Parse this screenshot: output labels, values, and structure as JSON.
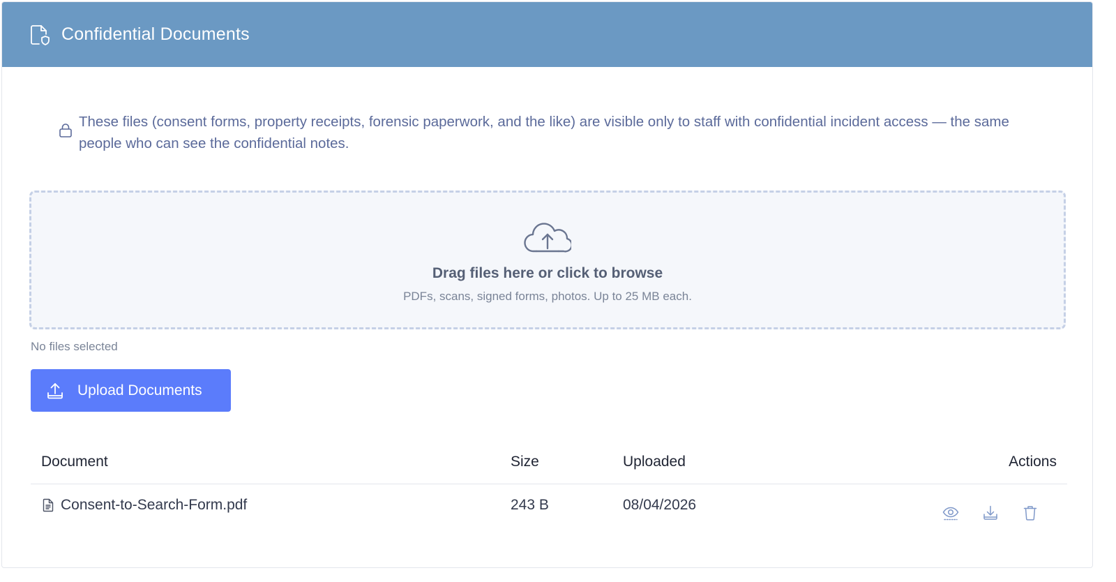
{
  "header": {
    "title": "Confidential Documents",
    "icon": "file-shield-icon",
    "background": "#6b99c3"
  },
  "notice": {
    "icon": "lock-icon",
    "text": "These files (consent forms, property receipts, forensic paperwork, and the like) are visible only to staff with confidential incident access — the same people who can see the confidential notes."
  },
  "dropzone": {
    "icon": "cloud-upload-icon",
    "title": "Drag files here or click to browse",
    "subtitle": "PDFs, scans, signed forms, photos. Up to 25 MB each."
  },
  "file_status": "No files selected",
  "upload_button": {
    "label": "Upload Documents",
    "icon": "upload-icon",
    "color": "#5b7cfb"
  },
  "table": {
    "headers": {
      "document": "Document",
      "size": "Size",
      "uploaded": "Uploaded",
      "actions": "Actions"
    },
    "rows": [
      {
        "icon": "file-icon",
        "name": "Consent-to-Search-Form.pdf",
        "size": "243 B",
        "uploaded": "08/04/2026",
        "actions": [
          "view-icon",
          "download-icon",
          "delete-icon"
        ]
      }
    ]
  }
}
